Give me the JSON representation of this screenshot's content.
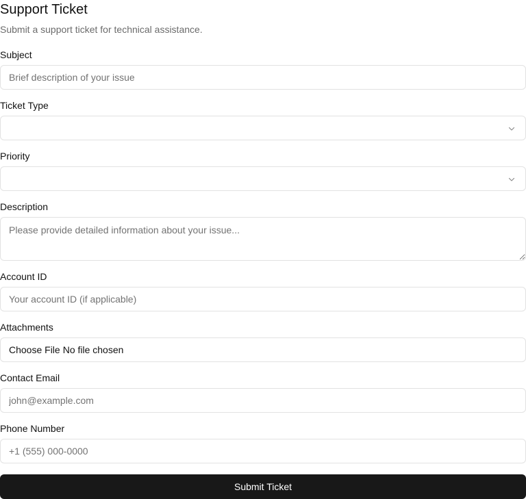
{
  "header": {
    "title": "Support Ticket",
    "subtitle": "Submit a support ticket for technical assistance."
  },
  "form": {
    "subject": {
      "label": "Subject",
      "placeholder": "Brief description of your issue",
      "value": ""
    },
    "ticket_type": {
      "label": "Ticket Type",
      "selected": "",
      "icon": "chevron-down-icon"
    },
    "priority": {
      "label": "Priority",
      "selected": "",
      "icon": "chevron-down-icon"
    },
    "description": {
      "label": "Description",
      "placeholder": "Please provide detailed information about your issue...",
      "value": ""
    },
    "account_id": {
      "label": "Account ID",
      "placeholder": "Your account ID (if applicable)",
      "value": ""
    },
    "attachments": {
      "label": "Attachments",
      "button_label": "Choose File",
      "status": "No file chosen"
    },
    "contact_email": {
      "label": "Contact Email",
      "placeholder": "john@example.com",
      "value": ""
    },
    "phone_number": {
      "label": "Phone Number",
      "placeholder": "+1 (555) 000-0000",
      "value": ""
    },
    "submit_label": "Submit Ticket"
  },
  "colors": {
    "submit_background": "#181818",
    "submit_text": "#ffffff",
    "border": "#e2e2e2",
    "placeholder": "#737373",
    "subtitle": "#6b6b6b"
  }
}
